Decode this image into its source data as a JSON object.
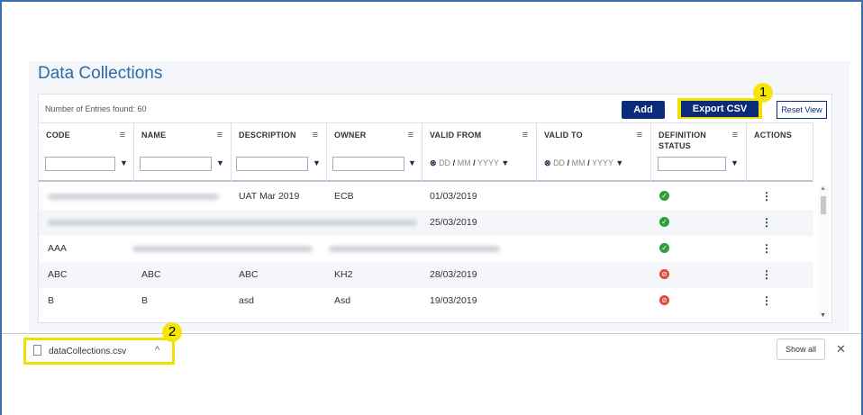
{
  "page_title": "Data Collections",
  "entries_label": "Number of Entries found: 60",
  "toolbar": {
    "add_label": "Add",
    "export_label": "Export CSV",
    "reset_label": "Reset View"
  },
  "badges": {
    "one": "1",
    "two": "2"
  },
  "columns": [
    {
      "key": "code",
      "label": "CODE"
    },
    {
      "key": "name",
      "label": "NAME"
    },
    {
      "key": "description",
      "label": "DESCRIPTION"
    },
    {
      "key": "owner",
      "label": "OWNER"
    },
    {
      "key": "valid_from",
      "label": "VALID FROM"
    },
    {
      "key": "valid_to",
      "label": "VALID TO"
    },
    {
      "key": "definition_status",
      "label": "DEFINITION STATUS"
    },
    {
      "key": "actions",
      "label": "ACTIONS"
    }
  ],
  "date_filter": {
    "dd": "DD",
    "mm": "MM",
    "yyyy": "YYYY",
    "sep": "/"
  },
  "rows": [
    {
      "code": "",
      "name": "",
      "description": "UAT Mar 2019",
      "owner": "ECB",
      "valid_from": "01/03/2019",
      "valid_to": "",
      "status": "valid"
    },
    {
      "code": "",
      "name": "",
      "description": "",
      "owner": "",
      "valid_from": "25/03/2019",
      "valid_to": "",
      "status": "valid"
    },
    {
      "code": "AAA",
      "name": "",
      "description": "",
      "owner": "",
      "valid_from": "",
      "valid_to": "",
      "status": "valid"
    },
    {
      "code": "ABC",
      "name": "ABC",
      "description": "ABC",
      "owner": "KH2",
      "valid_from": "28/03/2019",
      "valid_to": "",
      "status": "invalid"
    },
    {
      "code": "B",
      "name": "B",
      "description": "asd",
      "owner": "Asd",
      "valid_from": "19/03/2019",
      "valid_to": "",
      "status": "invalid"
    }
  ],
  "download": {
    "filename": "dataCollections.csv",
    "show_all_label": "Show all"
  },
  "icons": {
    "menu": "menu-icon",
    "filter": "filter-icon",
    "clear": "clear-icon",
    "check": "check-icon",
    "error": "error-icon",
    "kebab": "kebab-icon",
    "file": "file-icon",
    "chevron": "chevron-up-icon",
    "close": "close-icon"
  },
  "colors": {
    "accent": "#0a2a7a",
    "title": "#2c6aa8",
    "highlight": "#f0e000",
    "ok": "#2e9e3a",
    "error": "#e0483b"
  }
}
